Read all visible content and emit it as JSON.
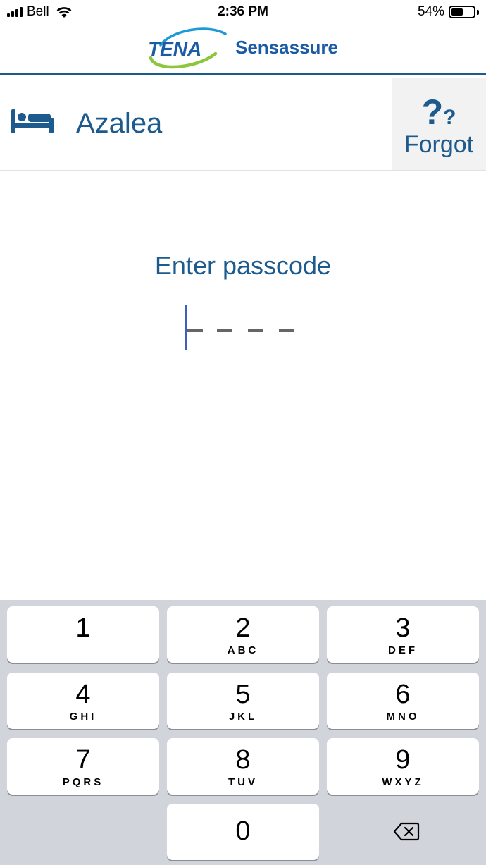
{
  "status_bar": {
    "carrier": "Bell",
    "time": "2:36 PM",
    "battery_percent": "54%",
    "battery_level": 0.54,
    "icons": [
      "cellular-signal-icon",
      "wifi-icon",
      "battery-icon"
    ]
  },
  "header": {
    "logo_text": "TENA",
    "brand": "Sensassure",
    "accent_color": "#1d5b8e"
  },
  "user": {
    "icon": "bed-icon",
    "name": "Azalea"
  },
  "forgot": {
    "icon": "question-marks-icon",
    "q_big": "?",
    "q_small": "?",
    "label": "Forgot"
  },
  "passcode": {
    "prompt": "Enter passcode",
    "length": 4,
    "entered": 0
  },
  "keypad": {
    "keys": [
      {
        "digit": "1",
        "letters": ""
      },
      {
        "digit": "2",
        "letters": "ABC"
      },
      {
        "digit": "3",
        "letters": "DEF"
      },
      {
        "digit": "4",
        "letters": "GHI"
      },
      {
        "digit": "5",
        "letters": "JKL"
      },
      {
        "digit": "6",
        "letters": "MNO"
      },
      {
        "digit": "7",
        "letters": "PQRS"
      },
      {
        "digit": "8",
        "letters": "TUV"
      },
      {
        "digit": "9",
        "letters": "WXYZ"
      },
      {
        "digit": "0",
        "letters": ""
      }
    ],
    "delete_icon": "backspace-icon"
  }
}
